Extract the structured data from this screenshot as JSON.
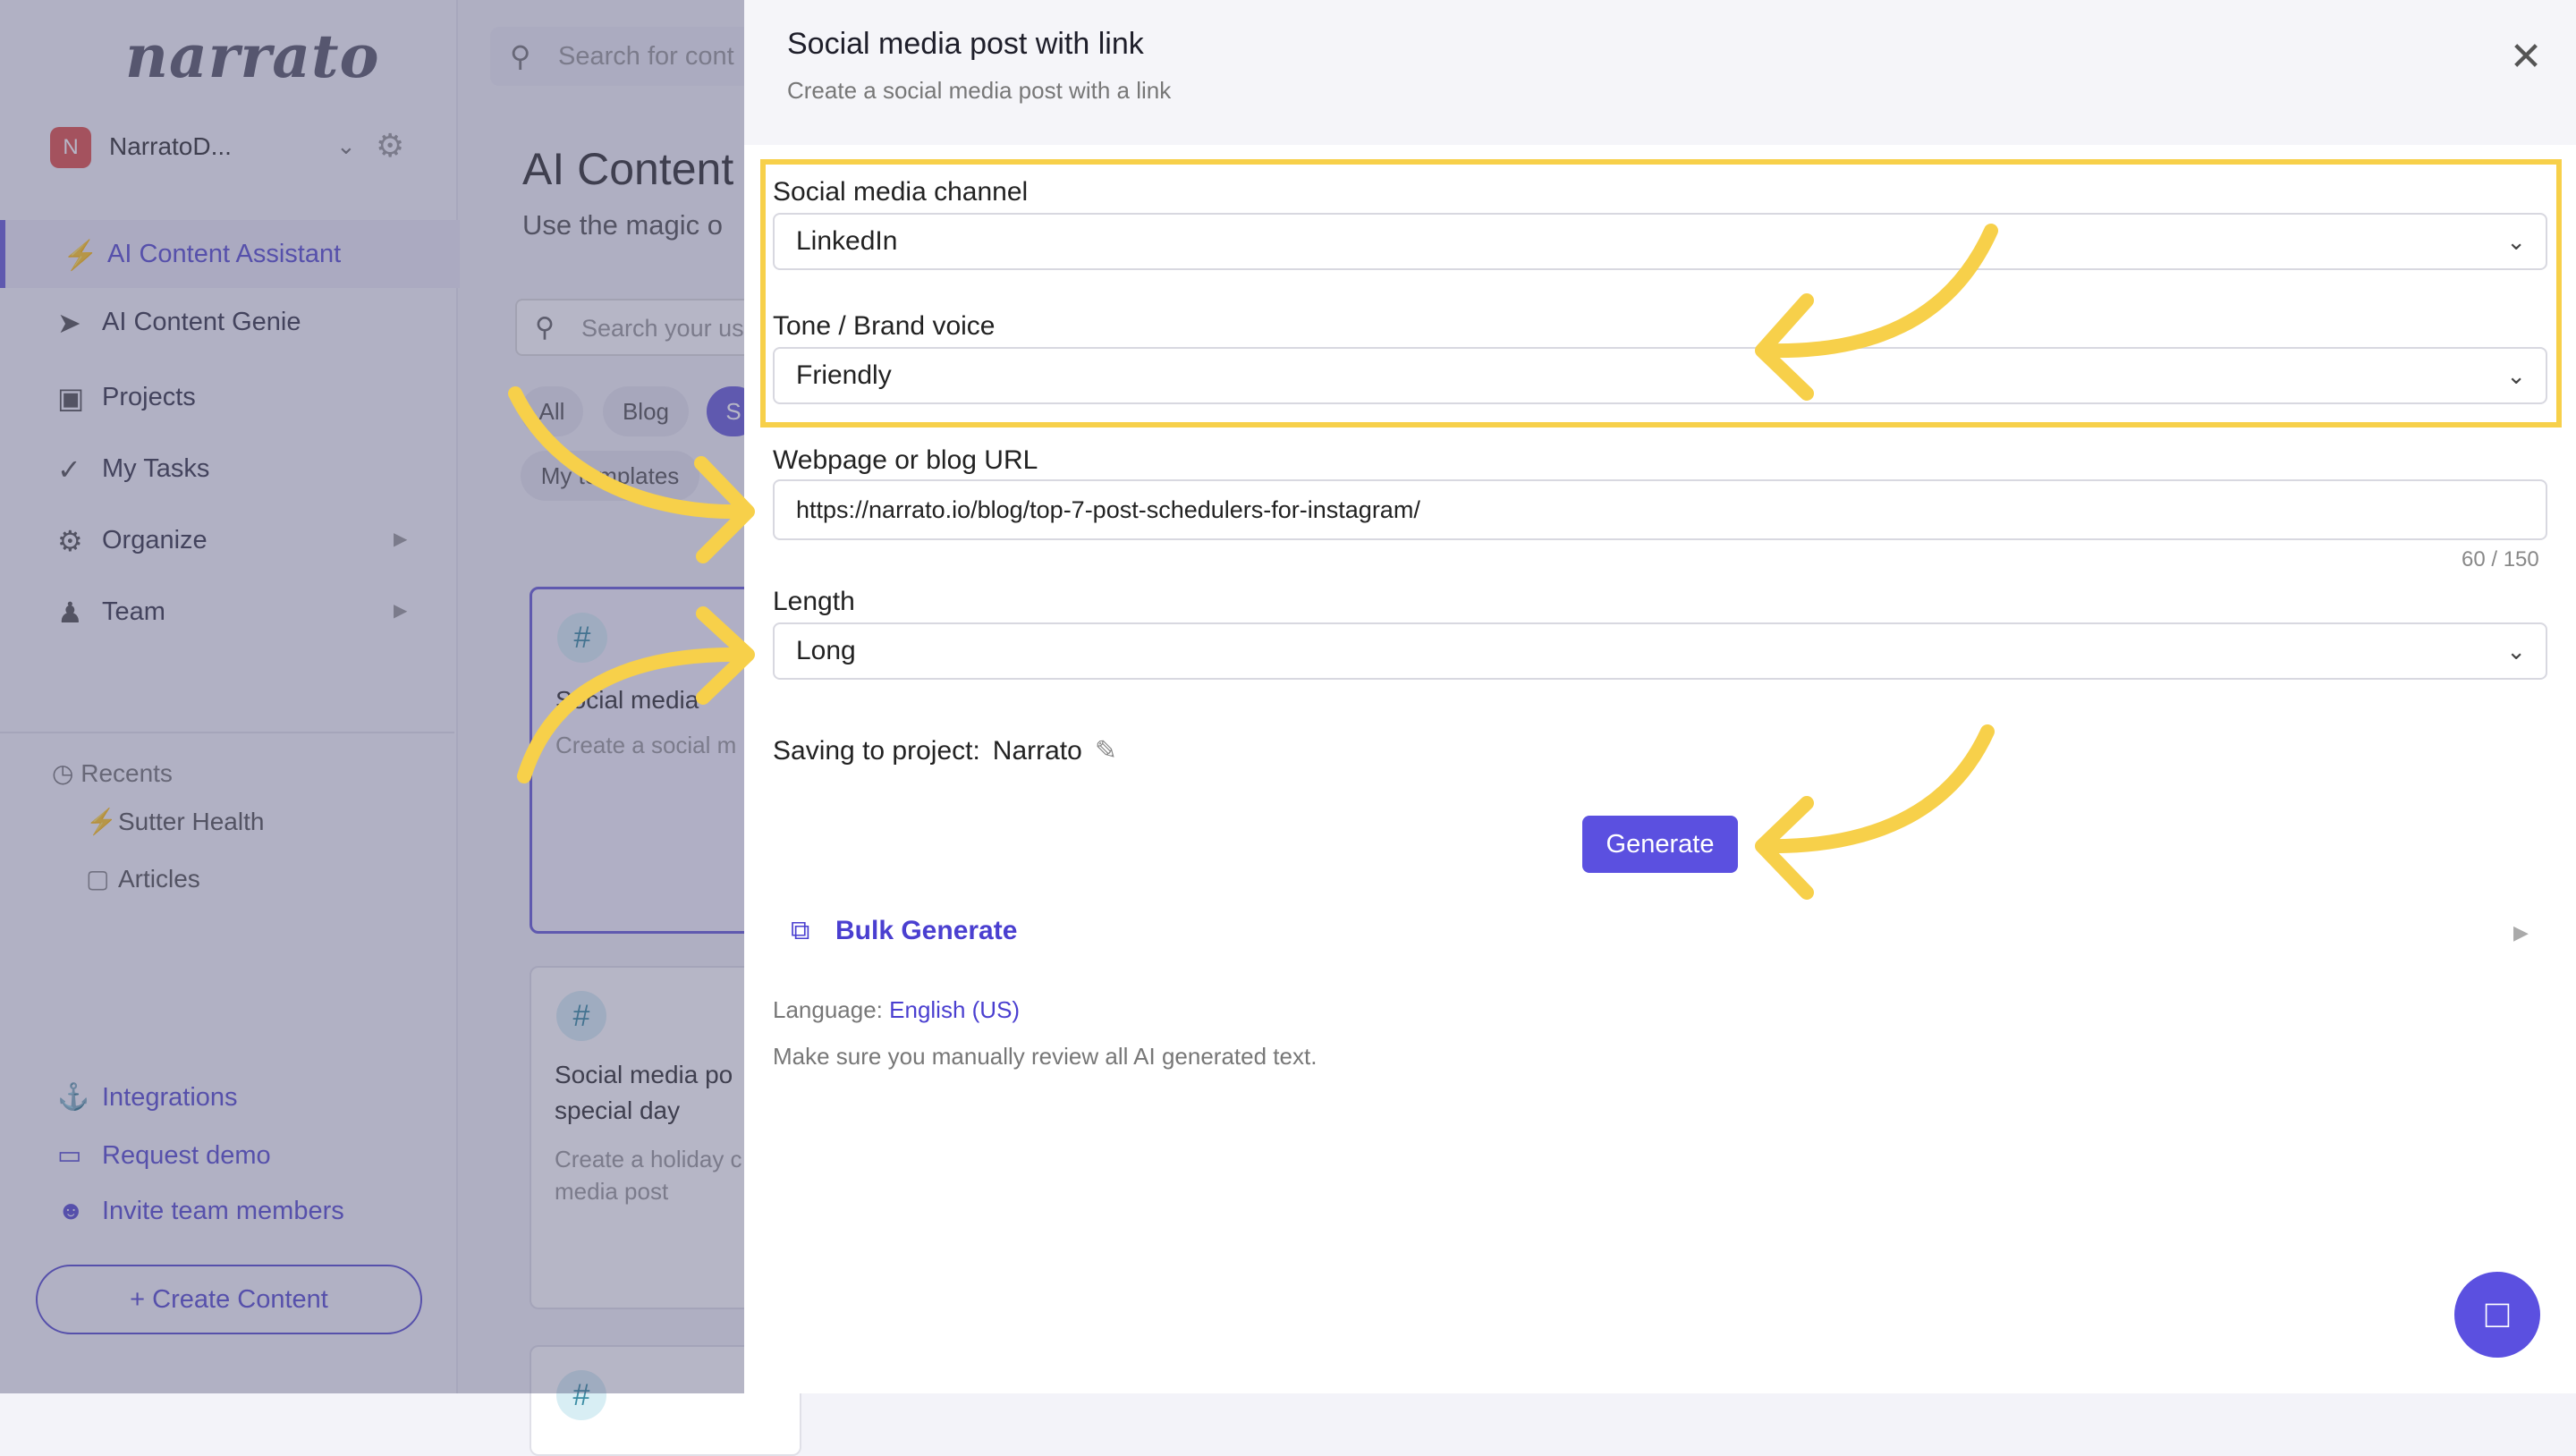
{
  "sidebar": {
    "logo": "narrato",
    "workspace": {
      "initial": "N",
      "name": "NarratoD..."
    },
    "nav": [
      {
        "label": "AI Content Assistant",
        "icon": "lightning-icon"
      },
      {
        "label": "AI Content Genie",
        "icon": "rocket-icon"
      },
      {
        "label": "Projects",
        "icon": "briefcase-icon"
      },
      {
        "label": "My Tasks",
        "icon": "check-icon"
      },
      {
        "label": "Organize",
        "icon": "gears-icon"
      },
      {
        "label": "Team",
        "icon": "team-icon"
      }
    ],
    "recents_title": "Recents",
    "recents": [
      {
        "label": "Sutter Health",
        "icon": "lightning-icon"
      },
      {
        "label": "Articles",
        "icon": "cube-icon"
      }
    ],
    "links": [
      {
        "label": "Integrations",
        "icon": "anchor-icon"
      },
      {
        "label": "Request demo",
        "icon": "monitor-icon"
      },
      {
        "label": "Invite team members",
        "icon": "add-user-icon"
      }
    ],
    "create_button": "+ Create Content"
  },
  "main": {
    "search_placeholder": "Search for cont",
    "title": "AI Content",
    "subtitle": "Use the magic o",
    "template_search_placeholder": "Search your us",
    "chips": [
      "All",
      "Blog",
      "S",
      "My templates"
    ],
    "cards": [
      {
        "title": "Social media",
        "desc": "Create a social m"
      },
      {
        "title": "Social media po special day",
        "desc": "Create a holiday c media post"
      }
    ]
  },
  "modal": {
    "title": "Social media post with link",
    "subtitle": "Create a social media post with a link",
    "fields": {
      "channel_label": "Social media channel",
      "channel_value": "LinkedIn",
      "tone_label": "Tone / Brand voice",
      "tone_value": "Friendly",
      "url_label": "Webpage or blog URL",
      "url_value": "https://narrato.io/blog/top-7-post-schedulers-for-instagram/",
      "url_counter": "60 / 150",
      "length_label": "Length",
      "length_value": "Long"
    },
    "saving_label": "Saving to project:",
    "saving_project": "Narrato",
    "generate_label": "Generate",
    "bulk_label": "Bulk Generate",
    "language_label": "Language:",
    "language_value": "English (US)",
    "review_note": "Make sure you manually review all AI generated text."
  },
  "colors": {
    "accent": "#5b50e0",
    "annotation": "#f7d04a"
  }
}
